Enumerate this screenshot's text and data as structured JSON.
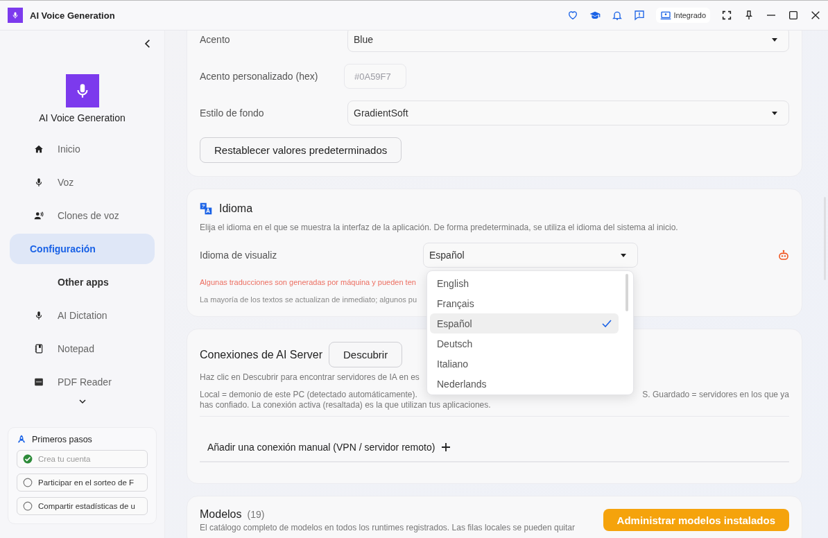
{
  "window": {
    "title": "AI Voice Generation",
    "mode_badge": "Integrado"
  },
  "sidebar": {
    "app_name": "AI Voice Generation",
    "items": [
      {
        "label": "Inicio",
        "selected": false
      },
      {
        "label": "Voz",
        "selected": false
      },
      {
        "label": "Clones de voz",
        "selected": false
      },
      {
        "label": "Configuración",
        "selected": true
      }
    ],
    "section_heading": "Other apps",
    "other_apps": [
      {
        "label": "AI Dictation"
      },
      {
        "label": "Notepad"
      },
      {
        "label": "PDF Reader"
      }
    ],
    "getting_started": {
      "title": "Primeros pasos",
      "steps": [
        {
          "label": "Crea tu cuenta",
          "checked": true
        },
        {
          "label": "Participar en el sorteo de F",
          "checked": false
        },
        {
          "label": "Compartir estadísticas de u",
          "checked": false
        }
      ]
    }
  },
  "appearance": {
    "rows": [
      {
        "kind": "select",
        "label": "Acento",
        "value": "Blue"
      },
      {
        "kind": "text",
        "label": "Acento personalizado (hex)",
        "placeholder": "#0A59F7"
      },
      {
        "kind": "select",
        "label": "Estilo de fondo",
        "value": "GradientSoft"
      }
    ],
    "reset_button": "Restablecer valores predeterminados"
  },
  "language": {
    "title": "Idioma",
    "description": "Elija el idioma en el que se muestra la interfaz de la aplicación. De forma predeterminada, se utiliza el idioma del sistema al inicio.",
    "field_label": "Idioma de visualiz",
    "value": "Español",
    "machine_note": "Algunas traducciones son generadas por máquina y pueden ten",
    "refresh_note": "La mayoría de los textos se actualizan de inmediato; algunos pu",
    "options": [
      {
        "label": "English",
        "selected": false
      },
      {
        "label": "Français",
        "selected": false
      },
      {
        "label": "Español",
        "selected": true
      },
      {
        "label": "Deutsch",
        "selected": false
      },
      {
        "label": "Italiano",
        "selected": false
      },
      {
        "label": "Nederlands",
        "selected": false
      }
    ]
  },
  "ai_server": {
    "title": "Conexiones de AI Server",
    "discover_button": "Descubrir",
    "hint": "Haz clic en Descubrir para encontrar servidores de IA en es",
    "legend_left": "Local = demonio de este PC (detectado automáticamente).",
    "legend_right": "S. Guardado = servidores en los que ya",
    "legend_line2": "has confiado. La conexión activa (resaltada) es la que utilizan tus aplicaciones.",
    "add_connection": "Añadir una conexión manual (VPN / servidor remoto)"
  },
  "models": {
    "title": "Modelos",
    "count": "(19)",
    "description": "El catálogo completo de modelos en todos los runtimes registrados. Las filas locales se pueden quitar",
    "manage_button": "Administrar modelos instalados"
  }
}
